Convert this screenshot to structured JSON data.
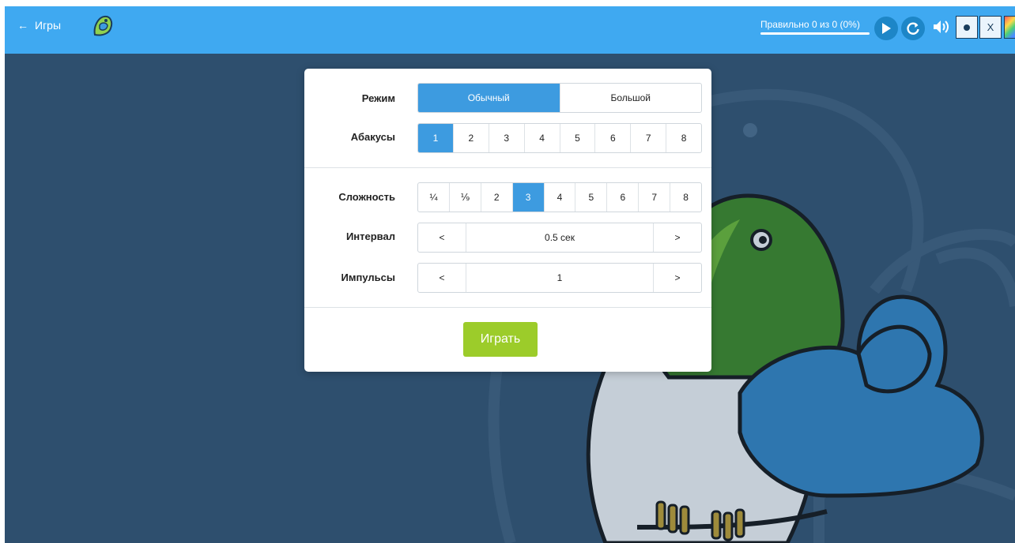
{
  "header": {
    "back_label": "Игры",
    "score_text": "Правильно 0 из 0 (0%)",
    "stop_label": "X"
  },
  "settings": {
    "mode": {
      "label": "Режим",
      "options": [
        "Обычный",
        "Большой"
      ],
      "selected": "Обычный"
    },
    "abacus": {
      "label": "Абакусы",
      "options": [
        "1",
        "2",
        "3",
        "4",
        "5",
        "6",
        "7",
        "8"
      ],
      "selected": "1"
    },
    "difficulty": {
      "label": "Сложность",
      "options": [
        "¼",
        "⅑",
        "2",
        "3",
        "4",
        "5",
        "6",
        "7",
        "8"
      ],
      "selected": "3"
    },
    "interval": {
      "label": "Интервал",
      "prev": "<",
      "value": "0.5 сек",
      "next": ">"
    },
    "impulses": {
      "label": "Импульсы",
      "prev": "<",
      "value": "1",
      "next": ">"
    },
    "play_label": "Играть"
  },
  "colors": {
    "topbar": "#3fa9f1",
    "background": "#2f4f6e",
    "active_option": "#3d9be0",
    "play_button": "#9ccc2a"
  },
  "icons": [
    "back-arrow-icon",
    "parrot-logo-icon",
    "play-icon",
    "restart-icon",
    "speaker-icon",
    "dot-icon",
    "palette-icon"
  ]
}
